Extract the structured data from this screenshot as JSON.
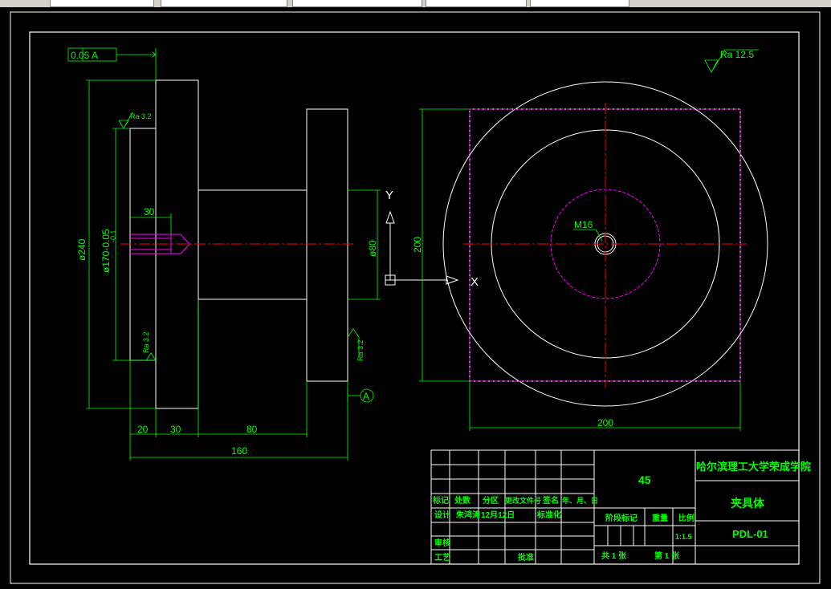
{
  "colors": {
    "background": "#000000",
    "outline": "#ffffff",
    "dimension": "#00ff00",
    "centerline": "#ff0000",
    "hidden": "#ff00ff"
  },
  "dimensions": {
    "tolerance_frame": "0.05 A",
    "ra_top_right": "Ra 12.5",
    "ra_left_top": "Ra 3.2",
    "ra_left_bottom": "Ra 3.2",
    "ra_right_face": "Ra 3.2",
    "dia_240": "ø240",
    "dia_170": "ø170-0.05",
    "dia_170_tol": "-0.1",
    "dia_80": "ø80",
    "thread_30": "30",
    "len_20": "20",
    "len_30": "30",
    "len_80": "80",
    "len_160": "160",
    "side_200_v": "200",
    "side_200_h": "200",
    "thread_m16": "M16",
    "datum_a": "A"
  },
  "ucs": {
    "x_label": "X",
    "y_label": "Y"
  },
  "title_block": {
    "material": "45",
    "school": "哈尔滨理工大学荣成学院",
    "part_name": "夹具体",
    "drawing_no": "PDL-01",
    "hdr_mark": "标记",
    "hdr_count": "处数",
    "hdr_zone": "分区",
    "hdr_docno": "更改文件号",
    "hdr_sign": "签名",
    "hdr_date": "年、月、日",
    "row_design": "设计",
    "designer": "朱鸿涛",
    "design_date": "12月12日",
    "row_standard": "标准化",
    "row_review": "审核",
    "row_process": "工艺",
    "row_approve": "批准",
    "stage": "阶段标记",
    "weight": "重量",
    "scale_label": "比例",
    "scale_value": "1:1.5",
    "total_sheets": "共  1  张",
    "sheet_no": "第  1  张"
  }
}
